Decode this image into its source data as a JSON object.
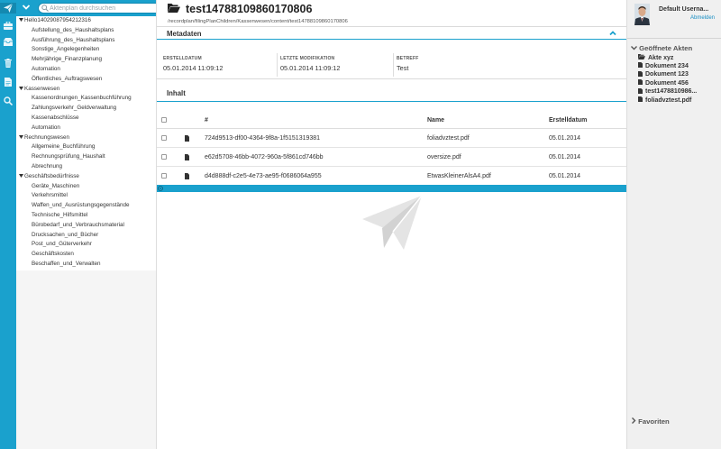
{
  "colors": {
    "accent": "#1aa1cd",
    "accent_dark": "#1489b0",
    "link": "#1a8fc4"
  },
  "rail": {
    "icons": [
      "paper-plane-icon",
      "briefcase-icon",
      "inbox-icon",
      "trash-icon",
      "document-icon",
      "search-icon"
    ]
  },
  "tree": {
    "search_placeholder": "Aktenplan durchsuchen",
    "items": [
      {
        "level": 0,
        "caret": true,
        "label": "Hello14029087954212316"
      },
      {
        "level": 2,
        "caret": false,
        "label": "Aufstellung_des_Haushaltsplans"
      },
      {
        "level": 2,
        "caret": false,
        "label": "Ausführung_des_Haushaltsplans"
      },
      {
        "level": 2,
        "caret": false,
        "label": "Sonstige_Angelegenheiten"
      },
      {
        "level": 2,
        "caret": false,
        "label": "Mehrjährige_Finanzplanung"
      },
      {
        "level": 2,
        "caret": false,
        "label": "Automation"
      },
      {
        "level": 2,
        "caret": false,
        "label": "Öffentliches_Auftragswesen"
      },
      {
        "level": 0,
        "caret": true,
        "label": "Kassenwesen"
      },
      {
        "level": 2,
        "caret": false,
        "label": "Kassenordnungen_Kassenbuchführung"
      },
      {
        "level": 2,
        "caret": false,
        "label": "Zahlungsverkehr_Geldverwaltung"
      },
      {
        "level": 2,
        "caret": false,
        "label": "Kassenabschlüsse"
      },
      {
        "level": 2,
        "caret": false,
        "label": "Automation"
      },
      {
        "level": 0,
        "caret": true,
        "label": "Rechnungswesen"
      },
      {
        "level": 2,
        "caret": false,
        "label": "Allgemeine_Buchführung"
      },
      {
        "level": 2,
        "caret": false,
        "label": "Rechnungsprüfung_Haushalt"
      },
      {
        "level": 2,
        "caret": false,
        "label": "Abrechnung"
      },
      {
        "level": 0,
        "caret": true,
        "label": "Geschäftsbedürfnisse"
      },
      {
        "level": 2,
        "caret": false,
        "label": "Geräte_Maschinen"
      },
      {
        "level": 2,
        "caret": false,
        "label": "Verkehrsmittel"
      },
      {
        "level": 2,
        "caret": false,
        "label": "Waffen_und_Ausrüstungsgegenstände"
      },
      {
        "level": 2,
        "caret": false,
        "label": "Technische_Hilfsmittel"
      },
      {
        "level": 2,
        "caret": false,
        "label": "Bürobedarf_und_Verbrauchsmaterial"
      },
      {
        "level": 2,
        "caret": false,
        "label": "Drucksachen_und_Bücher"
      },
      {
        "level": 2,
        "caret": false,
        "label": "Post_und_Güterverkehr"
      },
      {
        "level": 2,
        "caret": false,
        "label": "Geschäftskosten"
      },
      {
        "level": 2,
        "caret": false,
        "label": "Beschaffen_und_Verwalten"
      }
    ]
  },
  "main": {
    "title": "test14788109860170806",
    "path": "/recordplan/filingPlanChildren/Kassenwesen/content/test14788109860170806",
    "metadata_title": "Metadaten",
    "meta": {
      "created_label": "ERSTELLDATUM",
      "created_value": "05.01.2014 11:09:12",
      "modified_label": "LETZTE MODIFIKATION",
      "modified_value": "05.01.2014 11:09:12",
      "subject_label": "BETREFF",
      "subject_value": "Test"
    },
    "content_title": "Inhalt",
    "table": {
      "headers": {
        "hash": "#",
        "name": "Name",
        "date": "Erstelldatum"
      },
      "rows": [
        {
          "hash": "724d9513-df00-4364-9f8a-1f5151319381",
          "name": "foliadvztest.pdf",
          "date": "05.01.2014"
        },
        {
          "hash": "e62d5708-46bb-4072-960a-5f861cd746bb",
          "name": "oversize.pdf",
          "date": "05.01.2014"
        },
        {
          "hash": "d4d888df-c2e5-4e73-ae95-f0686064a955",
          "name": "EtwasKleinerAlsA4.pdf",
          "date": "05.01.2014"
        }
      ]
    }
  },
  "right": {
    "username": "Default Userna...",
    "logout": "Abmelden",
    "open_files_title": "Geöffnete Akten",
    "open_files": [
      {
        "label": "Akte xyz",
        "icon": "folder-open-icon"
      },
      {
        "label": "Dokument 234",
        "icon": "file-icon"
      },
      {
        "label": "Dokument 123",
        "icon": "file-icon"
      },
      {
        "label": "Dokument 456",
        "icon": "file-icon"
      },
      {
        "label": "test1478810986...",
        "icon": "file-icon"
      },
      {
        "label": "foliadvztest.pdf",
        "icon": "file-icon"
      }
    ],
    "favorites_title": "Favoriten"
  }
}
